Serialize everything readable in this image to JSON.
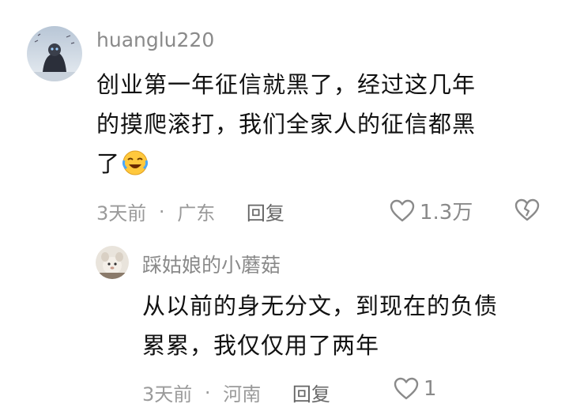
{
  "comments": [
    {
      "username": "huanglu220",
      "text_lines": [
        "创业第一年征信就黑了，经过这几年",
        "的摸爬滚打，我们全家人的征信都黑",
        "了"
      ],
      "emoji": "laugh-cry-emoji",
      "time": "3天前",
      "separator": "·",
      "location": "广东",
      "reply_label": "回复",
      "likes": "1.3万"
    },
    {
      "username": "踩姑娘的小蘑菇",
      "text_lines": [
        "从以前的身无分文，到现在的负债",
        "累累，我仅仅用了两年"
      ],
      "time": "3天前",
      "separator": "·",
      "location": "河南",
      "reply_label": "回复",
      "likes": "1"
    }
  ],
  "colors": {
    "text": "#111111",
    "meta": "#9a9a9a",
    "username": "#8a8a8a"
  }
}
